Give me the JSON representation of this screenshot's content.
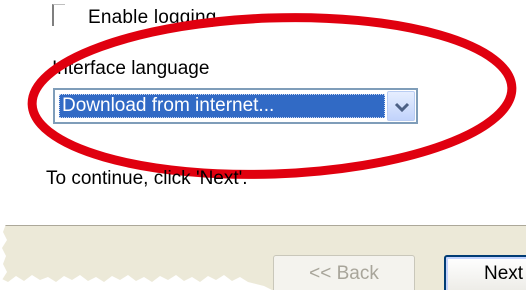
{
  "options": {
    "enable_logging_label": "Enable logging",
    "enable_logging_checked": false
  },
  "language": {
    "label": "Interface language",
    "selected_value": "Download from internet..."
  },
  "instructions": {
    "continue_text": "To continue, click 'Next'."
  },
  "buttons": {
    "back_label": "<< Back",
    "next_label": "Next"
  },
  "colors": {
    "highlight": "#316ac5",
    "annotation": "#e0000f",
    "footer_bg": "#ece9d8"
  }
}
